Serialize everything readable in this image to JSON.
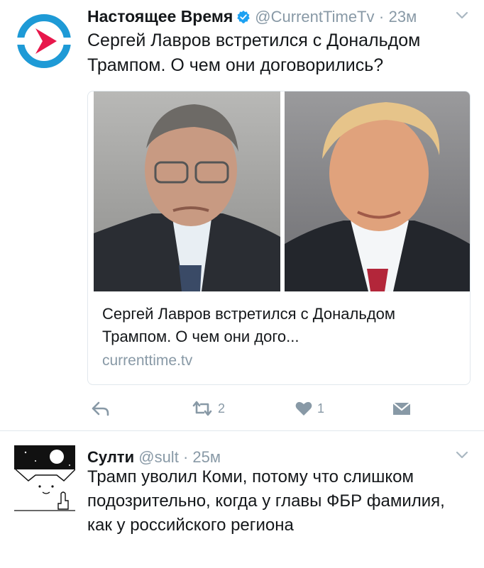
{
  "tweets": [
    {
      "name": "Настоящее Время",
      "handle": "@CurrentTimeTv",
      "separator": "·",
      "time": "23м",
      "text": "Сергей Лавров встретился с Дональдом Трампом. О чем они договорились?",
      "card": {
        "title": "Сергей Лавров встретился с Дональдом Трампом. О чем они дого...",
        "domain": "currenttime.tv"
      },
      "actions": {
        "reply_icon": "reply-icon",
        "retweet_count": "2",
        "like_count": "1",
        "dm_icon": "direct-message-icon"
      }
    },
    {
      "name": "Султи",
      "handle": "@sult",
      "separator": "·",
      "time": "25м",
      "text": "Трамп уволил Коми, потому что слишком подозрительно, когда у главы ФБР фамилия, как у российского региона"
    }
  ],
  "colors": {
    "text": "#14171a",
    "muted": "#8899a6",
    "verified": "#1da1f2",
    "brand_blue": "#1e9ad6",
    "brand_red": "#e8174b"
  }
}
